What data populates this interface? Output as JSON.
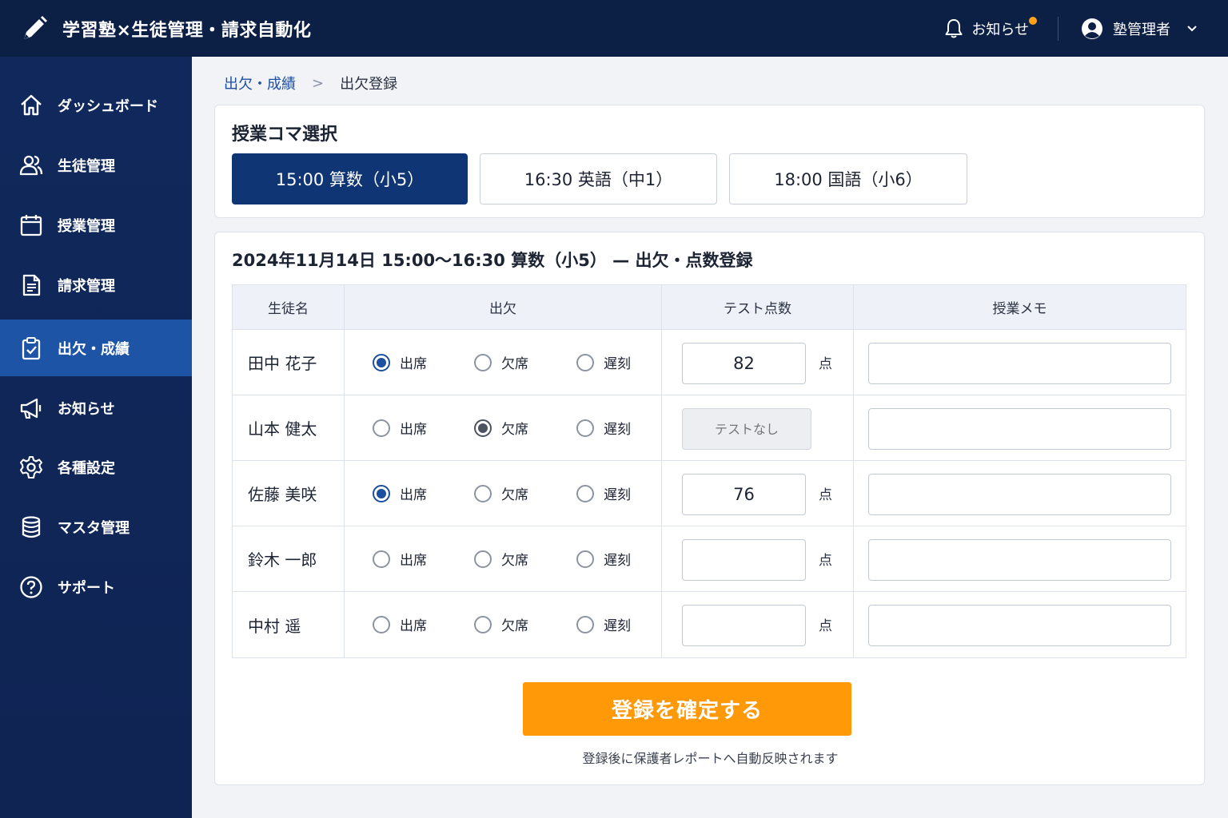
{
  "header": {
    "app_title": "学習塾×生徒管理・請求自動化",
    "logo_icon": "pencil-icon",
    "notifications_label": "お知らせ",
    "user_name": "塾管理者",
    "colors": {
      "bar": "#0c1f45",
      "badge": "#ffa21a"
    }
  },
  "sidebar": {
    "items": [
      {
        "label": "ダッシュボード",
        "icon": "home-icon"
      },
      {
        "label": "生徒管理",
        "icon": "users-icon"
      },
      {
        "label": "授業管理",
        "icon": "calendar-icon"
      },
      {
        "label": "請求管理",
        "icon": "document-icon"
      },
      {
        "label": "出欠・成績",
        "icon": "clipboard-check-icon",
        "active": true
      },
      {
        "label": "お知らせ",
        "icon": "megaphone-icon"
      },
      {
        "label": "各種設定",
        "icon": "gear-icon"
      },
      {
        "label": "マスタ管理",
        "icon": "database-icon"
      },
      {
        "label": "サポート",
        "icon": "help-circle-icon"
      }
    ]
  },
  "breadcrumb": {
    "parent": "出欠・成績",
    "separator": ">",
    "current": "出欠登録"
  },
  "lesson_select": {
    "title": "授業コマ選択",
    "tabs": [
      {
        "label": "15:00 算数（小5）",
        "selected": true
      },
      {
        "label": "16:30 英語（中1）",
        "selected": false
      },
      {
        "label": "18:00 国語（小6）",
        "selected": false
      }
    ]
  },
  "session": {
    "title": "2024年11月14日 15:00〜16:30 算数（小5） — 出欠・点数登録",
    "columns": [
      "生徒名",
      "出欠",
      "テスト点数",
      "授業メモ"
    ],
    "attendance_options": [
      "出席",
      "欠席",
      "遅刻"
    ],
    "score_unit": "点",
    "no_test_label": "テストなし",
    "students": [
      {
        "name": "田中 花子",
        "attendance": "出席",
        "score": "82",
        "no_test": false
      },
      {
        "name": "山本 健太",
        "attendance": "欠席",
        "score": "",
        "no_test": true
      },
      {
        "name": "佐藤 美咲",
        "attendance": "出席",
        "score": "76",
        "no_test": false
      },
      {
        "name": "鈴木 一郎",
        "attendance": "",
        "score": "",
        "no_test": false
      },
      {
        "name": "中村 遥",
        "attendance": "",
        "score": "",
        "no_test": false
      }
    ]
  },
  "actions": {
    "submit_label": "登録を確定する",
    "note": "登録後に保護者レポートへ自動反映されます",
    "colors": {
      "submit": "#ff9908",
      "primary": "#0f3575"
    }
  }
}
